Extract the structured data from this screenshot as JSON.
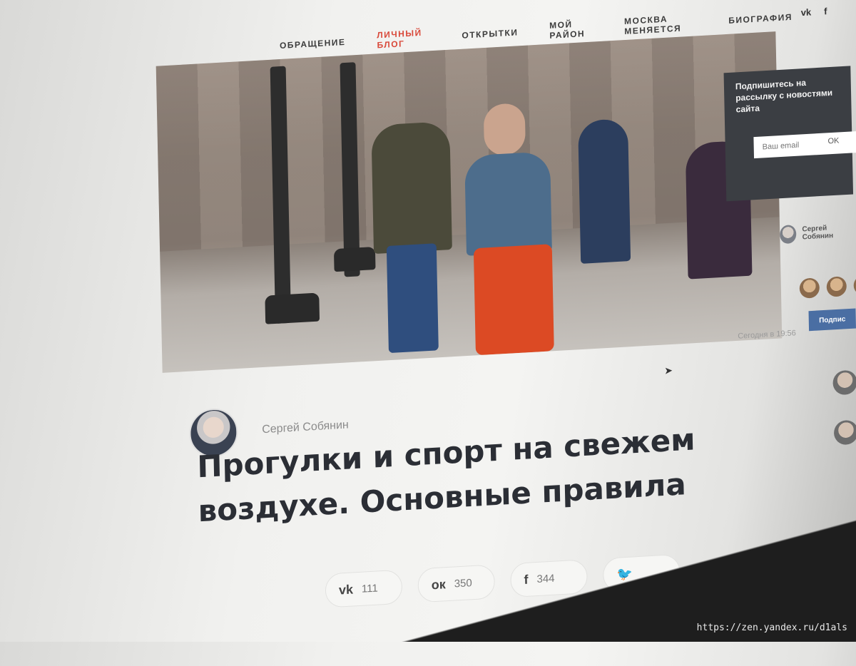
{
  "nav": {
    "items": [
      "ОБРАЩЕНИЕ",
      "ЛИЧНЫЙ БЛОГ",
      "ОТКРЫТКИ",
      "МОЙ РАЙОН",
      "МОСКВА МЕНЯЕТСЯ",
      "БИОГРАФИЯ"
    ],
    "active_index": 1
  },
  "social_top": {
    "vk": "vk",
    "fb": "f"
  },
  "sidebar": {
    "title": "Подпишитесь на рассылку с новостями сайта",
    "email_placeholder": "Ваш email",
    "ok_label": "OK"
  },
  "side_author": {
    "name": "Сергей Собянин"
  },
  "join_button": "Подпис",
  "post": {
    "time": "Сегодня в 19:56",
    "author": "Сергей Собянин",
    "headline": "Прогулки и спорт на свежем воздухе. Основные правила"
  },
  "shares": [
    {
      "icon": "vk-icon",
      "glyph": "vk",
      "count": "111"
    },
    {
      "icon": "odnoklassniki-icon",
      "glyph": "ок",
      "count": "350"
    },
    {
      "icon": "facebook-icon",
      "glyph": "f",
      "count": "344"
    },
    {
      "icon": "twitter-icon",
      "glyph": "🐦",
      "count": ""
    }
  ],
  "watermark": "https://zen.yandex.ru/d1als",
  "colors": {
    "accent": "#d9493a",
    "headline": "#2b2e35",
    "sidebar_bg": "#3b3e43",
    "vk_button": "#4a6ea3"
  }
}
